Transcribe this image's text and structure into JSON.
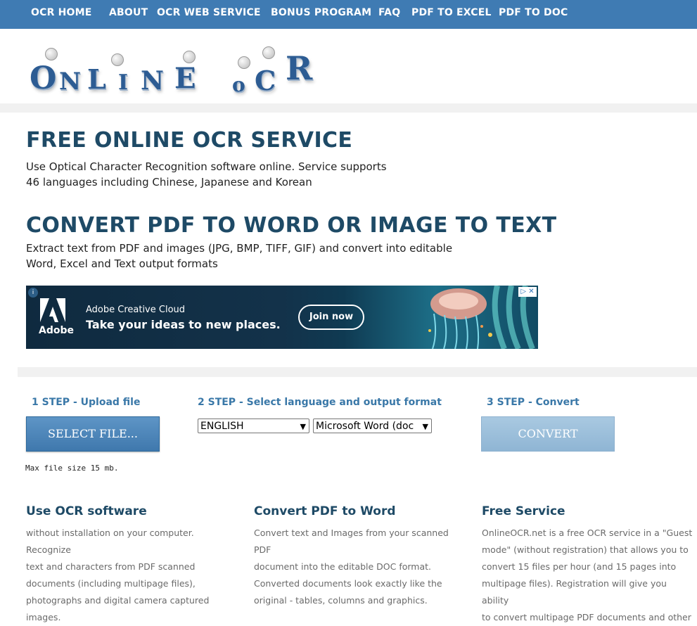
{
  "nav": {
    "items": [
      "OCR HOME",
      "ABOUT",
      "OCR WEB SERVICE",
      "BONUS PROGRAM",
      "FAQ",
      "PDF TO EXCEL",
      "PDF TO DOC"
    ]
  },
  "logo": {
    "text": "ONLINE OCR"
  },
  "hero": {
    "title": "FREE ONLINE OCR SERVICE",
    "desc_line1": "Use Optical Character Recognition software online. Service supports",
    "desc_line2": "46 languages including Chinese, Japanese and Korean",
    "title2": "CONVERT PDF TO WORD OR IMAGE TO TEXT",
    "desc2_line1": "Extract text from PDF and images (JPG, BMP, TIFF, GIF) and convert into editable",
    "desc2_line2": "Word, Excel and Text output formats"
  },
  "ad": {
    "brand": "Adobe",
    "line1": "Adobe Creative Cloud",
    "line2": "Take your ideas to new places.",
    "cta": "Join now"
  },
  "steps": {
    "step1": "1 STEP - Upload file",
    "step2": "2 STEP - Select language and output format",
    "step3": "3 STEP - Convert",
    "select_file": "SELECT FILE...",
    "language": "ENGLISH",
    "format": "Microsoft Word (doc",
    "convert": "CONVERT",
    "max_size": "Max file size 15 mb."
  },
  "columns": [
    {
      "title": "Use OCR software",
      "lines": [
        "without installation on your computer. Recognize",
        "text and characters from PDF scanned",
        "documents (including multipage files),",
        "photographs and digital camera captured",
        "images."
      ]
    },
    {
      "title": "Convert PDF to Word",
      "lines": [
        "Convert text and Images from your scanned PDF",
        "document into the editable DOC format.",
        "Converted documents look exactly like the",
        "original - tables, columns and graphics."
      ]
    },
    {
      "title": "Free Service",
      "lines": [
        "OnlineOCR.net is a free OCR service in a \"Guest",
        "mode\" (without registration) that allows you to",
        "convert 15 files per hour (and 15 pages into",
        "multipage files). Registration will give you ability",
        "to convert multipage PDF documents and other"
      ]
    }
  ],
  "colors": {
    "nav_bg": "#3f7bb3",
    "heading": "#1e4a66",
    "step": "#3a78a8",
    "button": "#4a86bb"
  }
}
